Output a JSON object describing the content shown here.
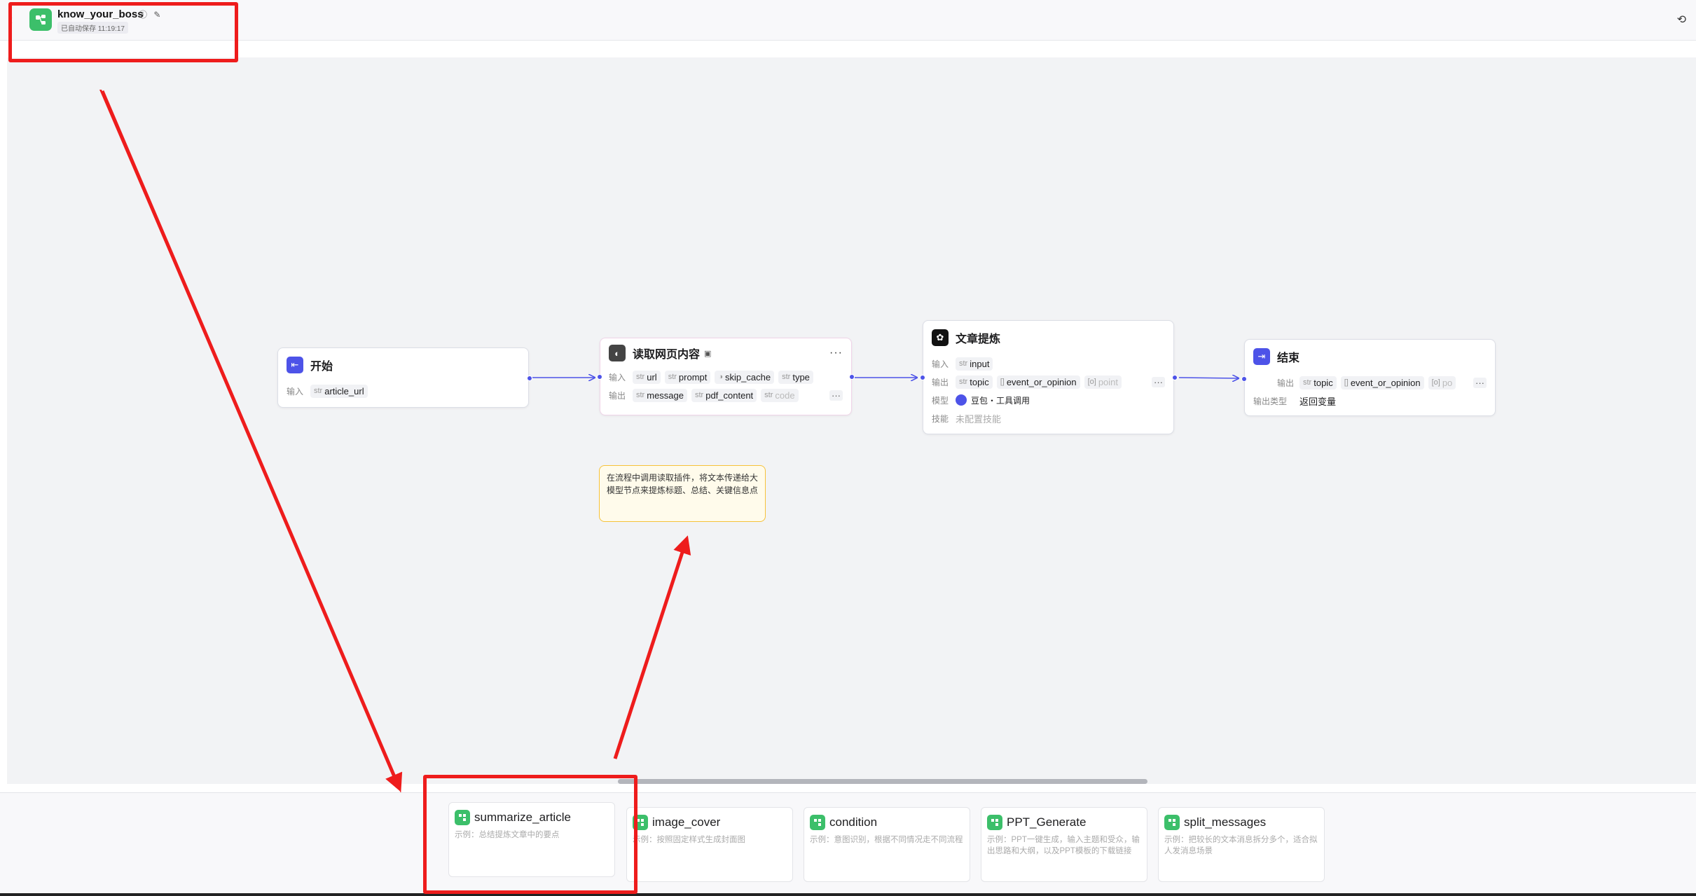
{
  "header": {
    "back_icon": "chevron-left-icon",
    "app_title": "know_your_boss",
    "autosave": "已自动保存 11:19:17",
    "history_icon": "history-icon"
  },
  "nodes": {
    "start": {
      "title": "开始",
      "input_label": "输入",
      "inputs": [
        {
          "type": "str",
          "name": "article_url"
        }
      ]
    },
    "read_web": {
      "title": "读取网页内容",
      "input_label": "输入",
      "inputs": [
        {
          "type": "str",
          "name": "url"
        },
        {
          "type": "str",
          "name": "prompt"
        },
        {
          "type": "",
          "name": "skip_cache"
        },
        {
          "type": "str",
          "name": "type"
        }
      ],
      "output_label": "输出",
      "outputs": [
        {
          "type": "str",
          "name": "message"
        },
        {
          "type": "str",
          "name": "pdf_content"
        },
        {
          "type": "str",
          "name": "code"
        }
      ]
    },
    "extract": {
      "title": "文章提炼",
      "input_label": "输入",
      "inputs": [
        {
          "type": "str",
          "name": "input"
        }
      ],
      "output_label": "输出",
      "outputs": [
        {
          "type": "str",
          "name": "topic"
        },
        {
          "type": "[]",
          "name": "event_or_opinion"
        },
        {
          "type": "[o]",
          "name": "point"
        }
      ],
      "model_label": "模型",
      "model_value": "豆包・工具调用",
      "skill_label": "技能",
      "skill_value": "未配置技能"
    },
    "end": {
      "title": "结束",
      "output_label": "输出",
      "outputs": [
        {
          "type": "str",
          "name": "topic"
        },
        {
          "type": "[]",
          "name": "event_or_opinion"
        },
        {
          "type": "[o]",
          "name": "po"
        }
      ],
      "output_type_label": "输出类型",
      "output_type_value": "返回变量"
    }
  },
  "note": {
    "text": "在流程中调用读取插件，将文本传递给大模型节点来提炼标题、总结、关键信息点"
  },
  "templates": [
    {
      "name": "summarize_article",
      "desc": "示例：总结提炼文章中的要点"
    },
    {
      "name": "image_cover",
      "desc": "示例：按照固定样式生成封面图"
    },
    {
      "name": "condition",
      "desc": "示例：意图识别，根据不同情况走不同流程"
    },
    {
      "name": "PPT_Generate",
      "desc": "示例：PPT一键生成，输入主题和受众，输出思路和大纲，以及PPT模板的下载链接"
    },
    {
      "name": "split_messages",
      "desc": "示例：把较长的文本消息拆分多个，适合拟人发消息场景"
    }
  ],
  "colors": {
    "accent": "#4d53e8",
    "brand_green": "#3cbf6a",
    "annotation_red": "#ee1c1c",
    "note_border": "#f6c23a"
  }
}
